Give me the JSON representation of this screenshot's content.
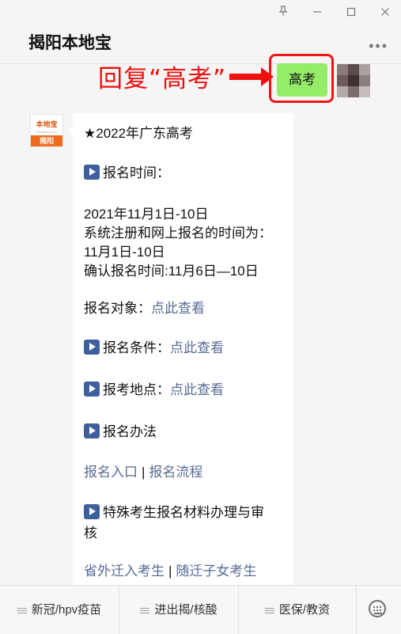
{
  "window": {
    "title": "揭阳本地宝",
    "pin_icon": "pin-icon",
    "minimize_icon": "minimize-icon",
    "maximize_icon": "maximize-icon",
    "close_icon": "close-icon",
    "more_icon": "more-dots-icon"
  },
  "annotation": {
    "text": "回复“高考”",
    "color": "#f00f0f"
  },
  "user_message": {
    "text": "高考",
    "bubble_color": "#95ec69"
  },
  "bot": {
    "avatar_logo": "本地宝",
    "avatar_sub": "Bendibao.com",
    "avatar_city": "揭阳"
  },
  "message": {
    "title": "★2022年广东高考",
    "reg_time_label": "报名时间：",
    "reg_date": "2021年11月1日-10日",
    "online_label": "系统注册和网上报名的时间为：",
    "online_date": "11月1日-10日",
    "confirm_line": "确认报名时间:11月6日—10日",
    "target_label": "报名对象：",
    "target_link": "点此查看",
    "condition_label": "报名条件：",
    "condition_link": "点此查看",
    "place_label": "报考地点：",
    "place_link": "点此查看",
    "method_label": "报名办法",
    "entry_link": "报名入口",
    "flow_link": "报名流程",
    "special_line1": "特殊考生报名材料办理与审",
    "special_line2": "核",
    "out_province_link": "省外迁入考生",
    "children_link": "随迁子女考生",
    "divider": "|",
    "link_color": "#576b95"
  },
  "bottom_menu": {
    "items": [
      "新冠/hpv疫苗",
      "进出揭/核酸",
      "医保/教资"
    ],
    "keyboard_icon": "keyboard-icon"
  }
}
